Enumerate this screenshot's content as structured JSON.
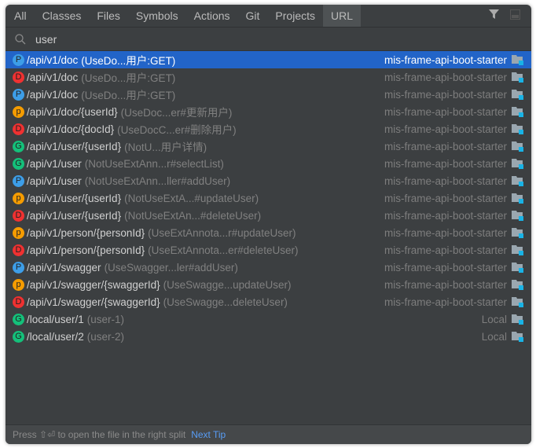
{
  "tabs": [
    "All",
    "Classes",
    "Files",
    "Symbols",
    "Actions",
    "Git",
    "Projects",
    "URL"
  ],
  "selected_tab": "URL",
  "search": {
    "value": "user"
  },
  "colors": {
    "P": "#3d9ee8",
    "D": "#ef3131",
    "p": "#f59c00",
    "G": "#14c07a",
    "selected": "#2264c8"
  },
  "rows": [
    {
      "badge": "P",
      "path": "/api/v1/doc",
      "desc": "(UseDo...用户:GET)",
      "loc": "mis-frame-api-boot-starter"
    },
    {
      "badge": "D",
      "path": "/api/v1/doc",
      "desc": "(UseDo...用户:GET)",
      "loc": "mis-frame-api-boot-starter"
    },
    {
      "badge": "P",
      "path": "/api/v1/doc",
      "desc": "(UseDo...用户:GET)",
      "loc": "mis-frame-api-boot-starter"
    },
    {
      "badge": "p",
      "path": "/api/v1/doc/{userId}",
      "desc": "(UseDoc...er#更新用户)",
      "loc": "mis-frame-api-boot-starter"
    },
    {
      "badge": "D",
      "path": "/api/v1/doc/{docId}",
      "desc": "(UseDocC...er#删除用户)",
      "loc": "mis-frame-api-boot-starter"
    },
    {
      "badge": "G",
      "path": "/api/v1/user/{userId}",
      "desc": "(NotU...用户详情)",
      "loc": "mis-frame-api-boot-starter"
    },
    {
      "badge": "G",
      "path": "/api/v1/user",
      "desc": "(NotUseExtAnn...r#selectList)",
      "loc": "mis-frame-api-boot-starter"
    },
    {
      "badge": "P",
      "path": "/api/v1/user",
      "desc": "(NotUseExtAnn...ller#addUser)",
      "loc": "mis-frame-api-boot-starter"
    },
    {
      "badge": "p",
      "path": "/api/v1/user/{userId}",
      "desc": "(NotUseExtA...#updateUser)",
      "loc": "mis-frame-api-boot-starter"
    },
    {
      "badge": "D",
      "path": "/api/v1/user/{userId}",
      "desc": "(NotUseExtAn...#deleteUser)",
      "loc": "mis-frame-api-boot-starter"
    },
    {
      "badge": "p",
      "path": "/api/v1/person/{personId}",
      "desc": "(UseExtAnnota...r#updateUser)",
      "loc": "mis-frame-api-boot-starter"
    },
    {
      "badge": "D",
      "path": "/api/v1/person/{personId}",
      "desc": "(UseExtAnnota...er#deleteUser)",
      "loc": "mis-frame-api-boot-starter"
    },
    {
      "badge": "P",
      "path": "/api/v1/swagger",
      "desc": "(UseSwagger...ler#addUser)",
      "loc": "mis-frame-api-boot-starter"
    },
    {
      "badge": "p",
      "path": "/api/v1/swagger/{swaggerId}",
      "desc": "(UseSwagge...updateUser)",
      "loc": "mis-frame-api-boot-starter"
    },
    {
      "badge": "D",
      "path": "/api/v1/swagger/{swaggerId}",
      "desc": "(UseSwagge...deleteUser)",
      "loc": "mis-frame-api-boot-starter"
    },
    {
      "badge": "G",
      "path": "/local/user/1",
      "desc": "(user-1)",
      "loc": "Local"
    },
    {
      "badge": "G",
      "path": "/local/user/2",
      "desc": "(user-2)",
      "loc": "Local"
    }
  ],
  "footer": {
    "text": "Press ⇧⏎ to open the file in the right split",
    "link": "Next Tip"
  }
}
